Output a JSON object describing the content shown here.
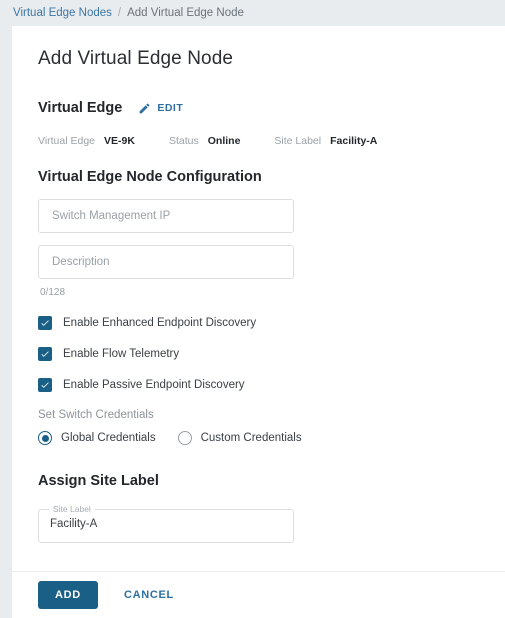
{
  "breadcrumb": {
    "parent": "Virtual Edge Nodes",
    "separator": "/",
    "current": "Add Virtual Edge Node"
  },
  "page": {
    "title": "Add Virtual Edge Node"
  },
  "virtual_edge": {
    "heading": "Virtual Edge",
    "edit_label": "EDIT",
    "edit_icon": "pencil-icon",
    "info": [
      {
        "label": "Virtual Edge",
        "value": "VE-9K"
      },
      {
        "label": "Status",
        "value": "Online"
      },
      {
        "label": "Site Label",
        "value": "Facility-A"
      }
    ]
  },
  "configuration": {
    "title": "Virtual Edge Node Configuration",
    "switch_ip": {
      "placeholder": "Switch Management IP",
      "value": ""
    },
    "description": {
      "placeholder": "Description",
      "value": "",
      "counter": "0/128"
    },
    "checkboxes": [
      {
        "label": "Enable Enhanced Endpoint Discovery",
        "checked": true
      },
      {
        "label": "Enable Flow Telemetry",
        "checked": true
      },
      {
        "label": "Enable Passive Endpoint Discovery",
        "checked": true
      }
    ],
    "credentials": {
      "group_label": "Set Switch Credentials",
      "options": [
        {
          "label": "Global Credentials",
          "selected": true
        },
        {
          "label": "Custom Credentials",
          "selected": false
        }
      ]
    }
  },
  "assign_site_label": {
    "title": "Assign Site Label",
    "field_legend": "Site Label",
    "field_value": "Facility-A"
  },
  "footer": {
    "add_label": "ADD",
    "cancel_label": "CANCEL"
  },
  "colors": {
    "accent": "#1a5f86",
    "link": "#2f6f9f",
    "page_bg": "#e9ecee",
    "card_bg": "#ffffff",
    "muted_text": "#9aa1a7"
  }
}
